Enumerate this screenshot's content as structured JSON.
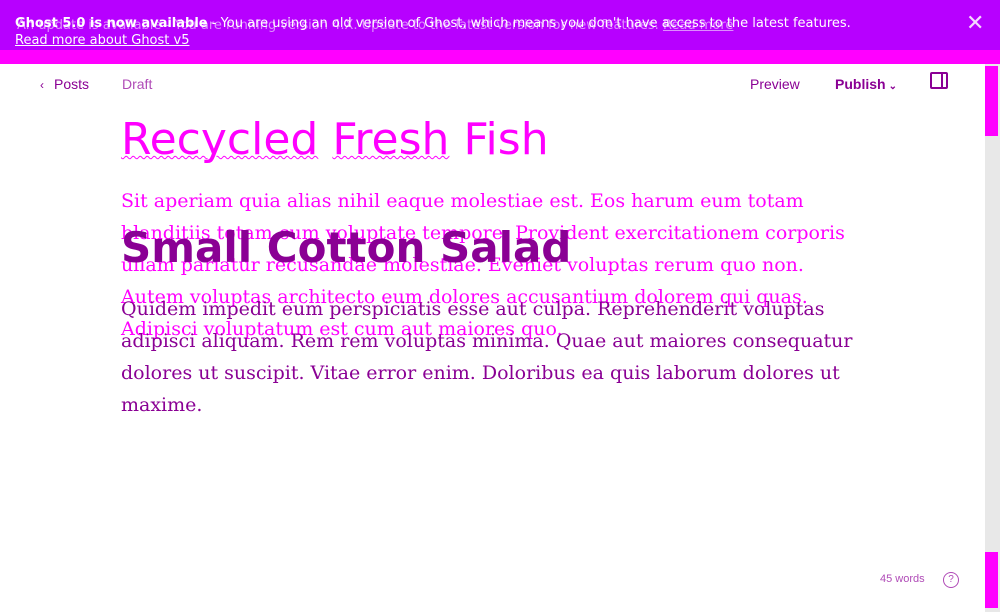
{
  "banner": {
    "text_a_strong": "Ghost 5.0 is now available",
    "text_a_rest": " - You are using an old version of Ghost, which means you don't have access to the latest features.",
    "read_more_label": "Read more about Ghost v5",
    "text_b": "An update is available - You are running version 4.X. Update to the latest version for new features.",
    "read_more_short": "Read more",
    "close_icon": "close-icon",
    "color": "#b700ff",
    "strip_color": "#ff00ff"
  },
  "toolbar": {
    "back_label": "Posts",
    "back_icon": "chevron-left-icon",
    "status": "Draft",
    "preview_label": "Preview",
    "publish_label": "Publish",
    "publish_icon": "chevron-down-icon",
    "settings_icon": "sidebar-toggle-icon"
  },
  "editor": {
    "title_a_words": [
      "Recycled",
      "Fresh",
      "Fish"
    ],
    "title_b": "Small Cotton Salad",
    "body_a": "Sit aperiam quia alias nihil eaque molestiae est. Eos harum eum totam blanditiis totam cum voluptate tempore. Provident exercitationem corporis ullam pariatur recusandae molestiae. Eveniet voluptas rerum quo non. Autem voluptas architecto eum dolores accusantium dolorem qui quas. Adipisci voluptatum est cum aut maiores quo.",
    "body_b": "Quidem impedit eum perspiciatis esse aut culpa. Reprehenderit voluptas adipisci aliquam. Rem rem voluptas minima. Quae aut maiores consequatur dolores ut suscipit. Vitae error enim. Doloribus ea quis laborum dolores ut maxime."
  },
  "footer": {
    "word_count": "45 words",
    "help_icon": "help-icon",
    "help_glyph": "?"
  },
  "colors": {
    "accent_magenta": "#ff00ff",
    "accent_purple": "#8a0094"
  }
}
